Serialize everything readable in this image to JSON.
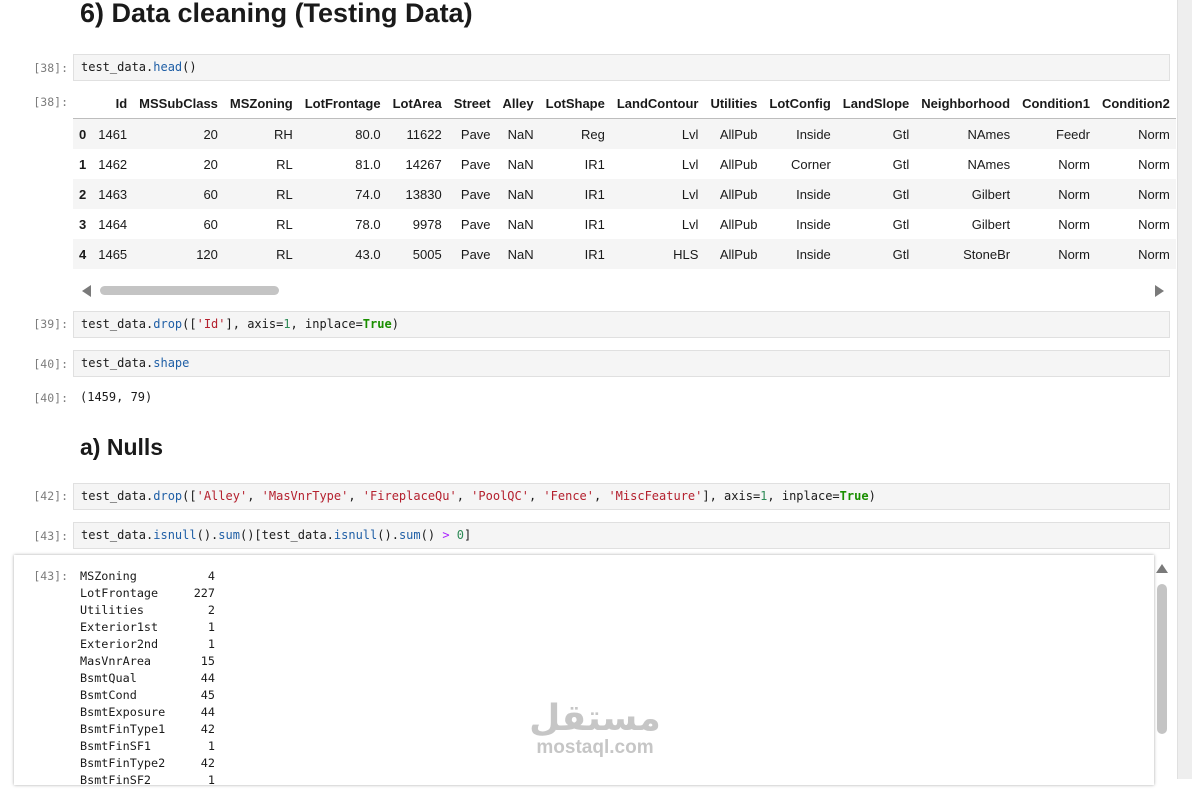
{
  "title": "6) Data cleaning (Testing Data)",
  "subtitle": "a) Nulls",
  "cells": {
    "c38_in_prompt": "[38]:",
    "c38_out_prompt": "[38]:",
    "c38_code": {
      "obj": "test_data.",
      "method": "head",
      "rest": "()"
    },
    "c39_prompt": "[39]:",
    "c39_code": {
      "obj": "test_data.",
      "method": "drop",
      "p1": "([",
      "s1": "'Id'",
      "p2": "], axis=",
      "n1": "1",
      "p3": ", inplace=",
      "k1": "True",
      "p4": ")"
    },
    "c40_in_prompt": "[40]:",
    "c40_code": {
      "obj": "test_data.",
      "attr": "shape"
    },
    "c40_out_prompt": "[40]:",
    "c40_output": "(1459, 79)",
    "c42_prompt": "[42]:",
    "c42_code": {
      "obj": "test_data.",
      "method": "drop",
      "p1": "([",
      "s1": "'Alley'",
      "s2": "'MasVnrType'",
      "s3": "'FireplaceQu'",
      "s4": "'PoolQC'",
      "s5": "'Fence'",
      "s6": "'MiscFeature'",
      "sep": ", ",
      "p2": "], axis=",
      "n1": "1",
      "p3": ", inplace=",
      "k1": "True",
      "p4": ")"
    },
    "c43_in_prompt": "[43]:",
    "c43_code": {
      "obj": "test_data.",
      "m1": "isnull",
      "p1": "().",
      "m2": "sum",
      "p2": "()[test_data.",
      "m3": "isnull",
      "p3": "().",
      "m4": "sum",
      "p4": "() ",
      "op": ">",
      "p5": " ",
      "n1": "0",
      "p6": "]"
    },
    "c43_out_prompt": "[43]:"
  },
  "dataframe": {
    "columns": [
      "",
      "Id",
      "MSSubClass",
      "MSZoning",
      "LotFrontage",
      "LotArea",
      "Street",
      "Alley",
      "LotShape",
      "LandContour",
      "Utilities",
      "LotConfig",
      "LandSlope",
      "Neighborhood",
      "Condition1",
      "Condition2"
    ],
    "rows": [
      [
        "0",
        "1461",
        "20",
        "RH",
        "80.0",
        "11622",
        "Pave",
        "NaN",
        "Reg",
        "Lvl",
        "AllPub",
        "Inside",
        "Gtl",
        "NAmes",
        "Feedr",
        "Norm"
      ],
      [
        "1",
        "1462",
        "20",
        "RL",
        "81.0",
        "14267",
        "Pave",
        "NaN",
        "IR1",
        "Lvl",
        "AllPub",
        "Corner",
        "Gtl",
        "NAmes",
        "Norm",
        "Norm"
      ],
      [
        "2",
        "1463",
        "60",
        "RL",
        "74.0",
        "13830",
        "Pave",
        "NaN",
        "IR1",
        "Lvl",
        "AllPub",
        "Inside",
        "Gtl",
        "Gilbert",
        "Norm",
        "Norm"
      ],
      [
        "3",
        "1464",
        "60",
        "RL",
        "78.0",
        "9978",
        "Pave",
        "NaN",
        "IR1",
        "Lvl",
        "AllPub",
        "Inside",
        "Gtl",
        "Gilbert",
        "Norm",
        "Norm"
      ],
      [
        "4",
        "1465",
        "120",
        "RL",
        "43.0",
        "5005",
        "Pave",
        "NaN",
        "IR1",
        "HLS",
        "AllPub",
        "Inside",
        "Gtl",
        "StoneBr",
        "Norm",
        "Norm"
      ]
    ]
  },
  "nulls": [
    [
      "MSZoning",
      "4"
    ],
    [
      "LotFrontage",
      "227"
    ],
    [
      "Utilities",
      "2"
    ],
    [
      "Exterior1st",
      "1"
    ],
    [
      "Exterior2nd",
      "1"
    ],
    [
      "MasVnrArea",
      "15"
    ],
    [
      "BsmtQual",
      "44"
    ],
    [
      "BsmtCond",
      "45"
    ],
    [
      "BsmtExposure",
      "44"
    ],
    [
      "BsmtFinType1",
      "42"
    ],
    [
      "BsmtFinSF1",
      "1"
    ],
    [
      "BsmtFinType2",
      "42"
    ],
    [
      "BsmtFinSF2",
      "1"
    ]
  ],
  "watermark": {
    "logo": "مستقل",
    "text": "mostaql.com"
  },
  "colors": {
    "string": "#b4202e",
    "keyword": "#1a8f00",
    "attribute": "#1f5fa6",
    "operator": "#aa22ff",
    "prompt": "#7d7d7d"
  }
}
